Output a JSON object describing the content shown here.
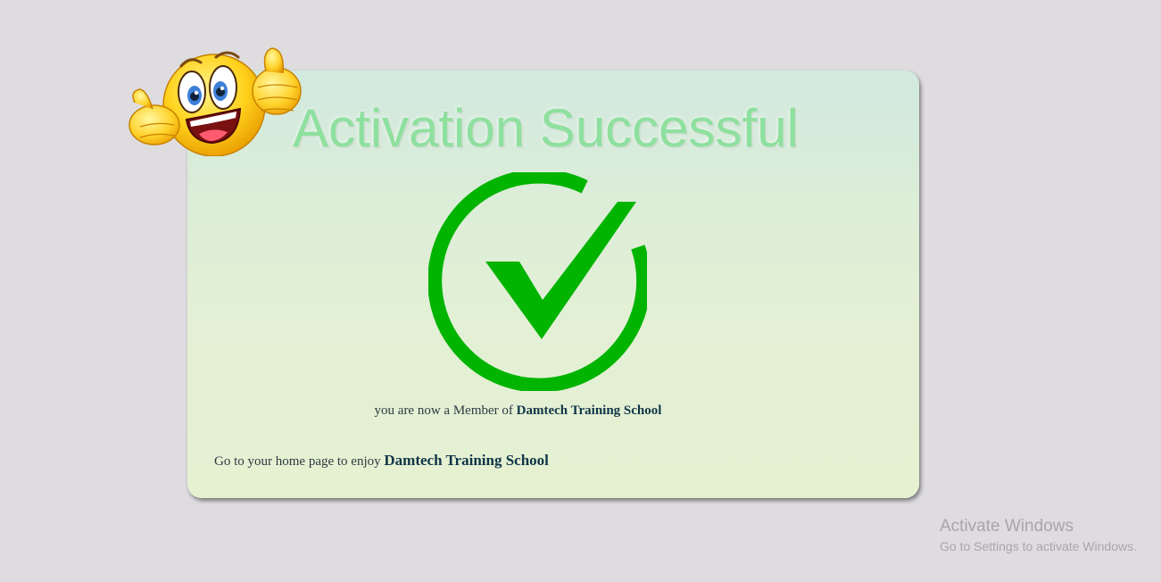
{
  "card": {
    "title": "Activation Successful",
    "member_prefix": "you are now a Member of",
    "member_school": "Damtech Training School",
    "home_prefix": "Go to your home page to enjoy",
    "home_school": "Damtech Training School"
  },
  "icons": {
    "emoji": "thumbs-up-emoji-icon",
    "success": "check-circle-icon"
  },
  "colors": {
    "page_background": "#dedcdf",
    "title_green": "#8ee09e",
    "check_green": "#00b400",
    "school_text": "#0f3547"
  },
  "watermark": {
    "title": "Activate Windows",
    "subtitle": "Go to Settings to activate Windows."
  }
}
